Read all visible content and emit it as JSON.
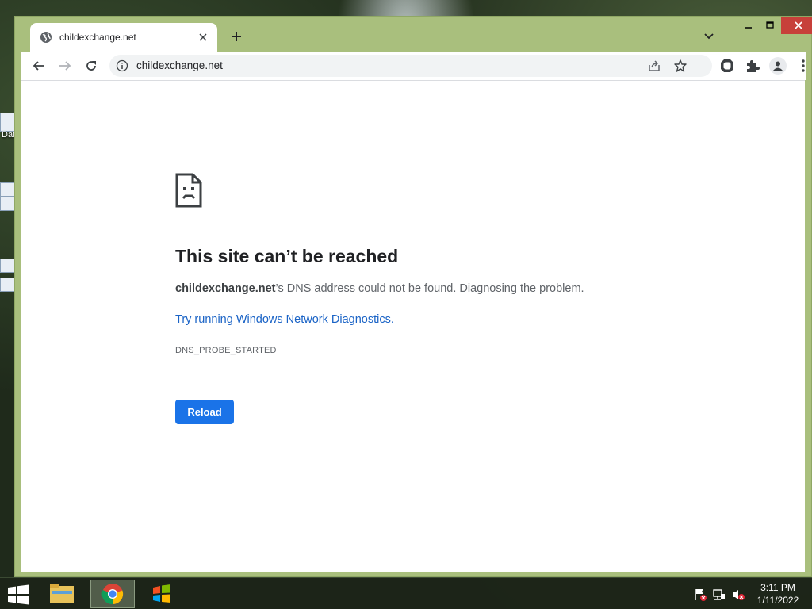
{
  "desktop": {
    "icon_label": "Dat"
  },
  "tab": {
    "title": "childexchange.net",
    "close_icon": "close-icon",
    "new_tab_icon": "plus-icon"
  },
  "window_controls": {
    "minimize": "minimize-icon",
    "maximize": "maximize-icon",
    "close": "close-icon"
  },
  "toolbar": {
    "url": "childexchange.net",
    "icons": [
      "back-arrow-icon",
      "forward-arrow-icon",
      "reload-icon",
      "info-icon",
      "share-icon",
      "star-icon",
      "extension-shield-icon",
      "puzzle-icon",
      "profile-icon",
      "kebab-menu-icon"
    ]
  },
  "error_page": {
    "title": "This site can’t be reached",
    "domain": "childexchange.net",
    "description_rest": "’s DNS address could not be found. Diagnosing the problem.",
    "link_text": "Try running Windows Network Diagnostics.",
    "error_code": "DNS_PROBE_STARTED",
    "reload_label": "Reload"
  },
  "taskbar": {
    "apps": [
      "file-explorer-icon",
      "chrome-icon",
      "windows-live-icon"
    ],
    "tray": [
      "action-center-flag-icon",
      "network-icon",
      "volume-muted-icon"
    ],
    "time": "3:11 PM",
    "date": "1/11/2022"
  },
  "colors": {
    "window_frame": "#a9bf7d",
    "reload_button": "#1a73e8",
    "link": "#1a63c6",
    "window_close": "#c7403a"
  }
}
